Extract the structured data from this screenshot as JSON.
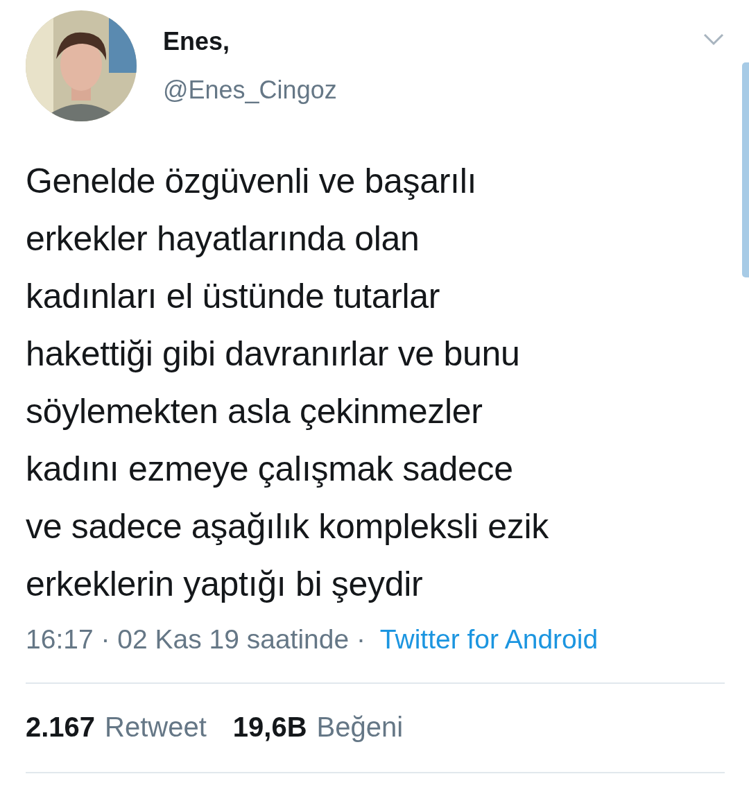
{
  "tweet": {
    "author": {
      "name": "Enes,",
      "handle": "@Enes_Cingoz"
    },
    "text": "Genelde özgüvenli ve başarılı\nerkekler hayatlarında olan\nkadınları el üstünde tutarlar\nhakettiği gibi davranırlar ve bunu\nsöylemekten asla çekinmezler\nkadını ezmeye çalışmak sadece\nve sadece aşağılık kompleksli ezik\nerkeklerin yaptığı bi şeydir",
    "timestamp": "16:17 · 02 Kas 19 saatinde ·",
    "source": "Twitter for Android",
    "stats": [
      {
        "count": "2.167",
        "label": "Retweet"
      },
      {
        "count": "19,6B",
        "label": "Beğeni"
      }
    ]
  }
}
